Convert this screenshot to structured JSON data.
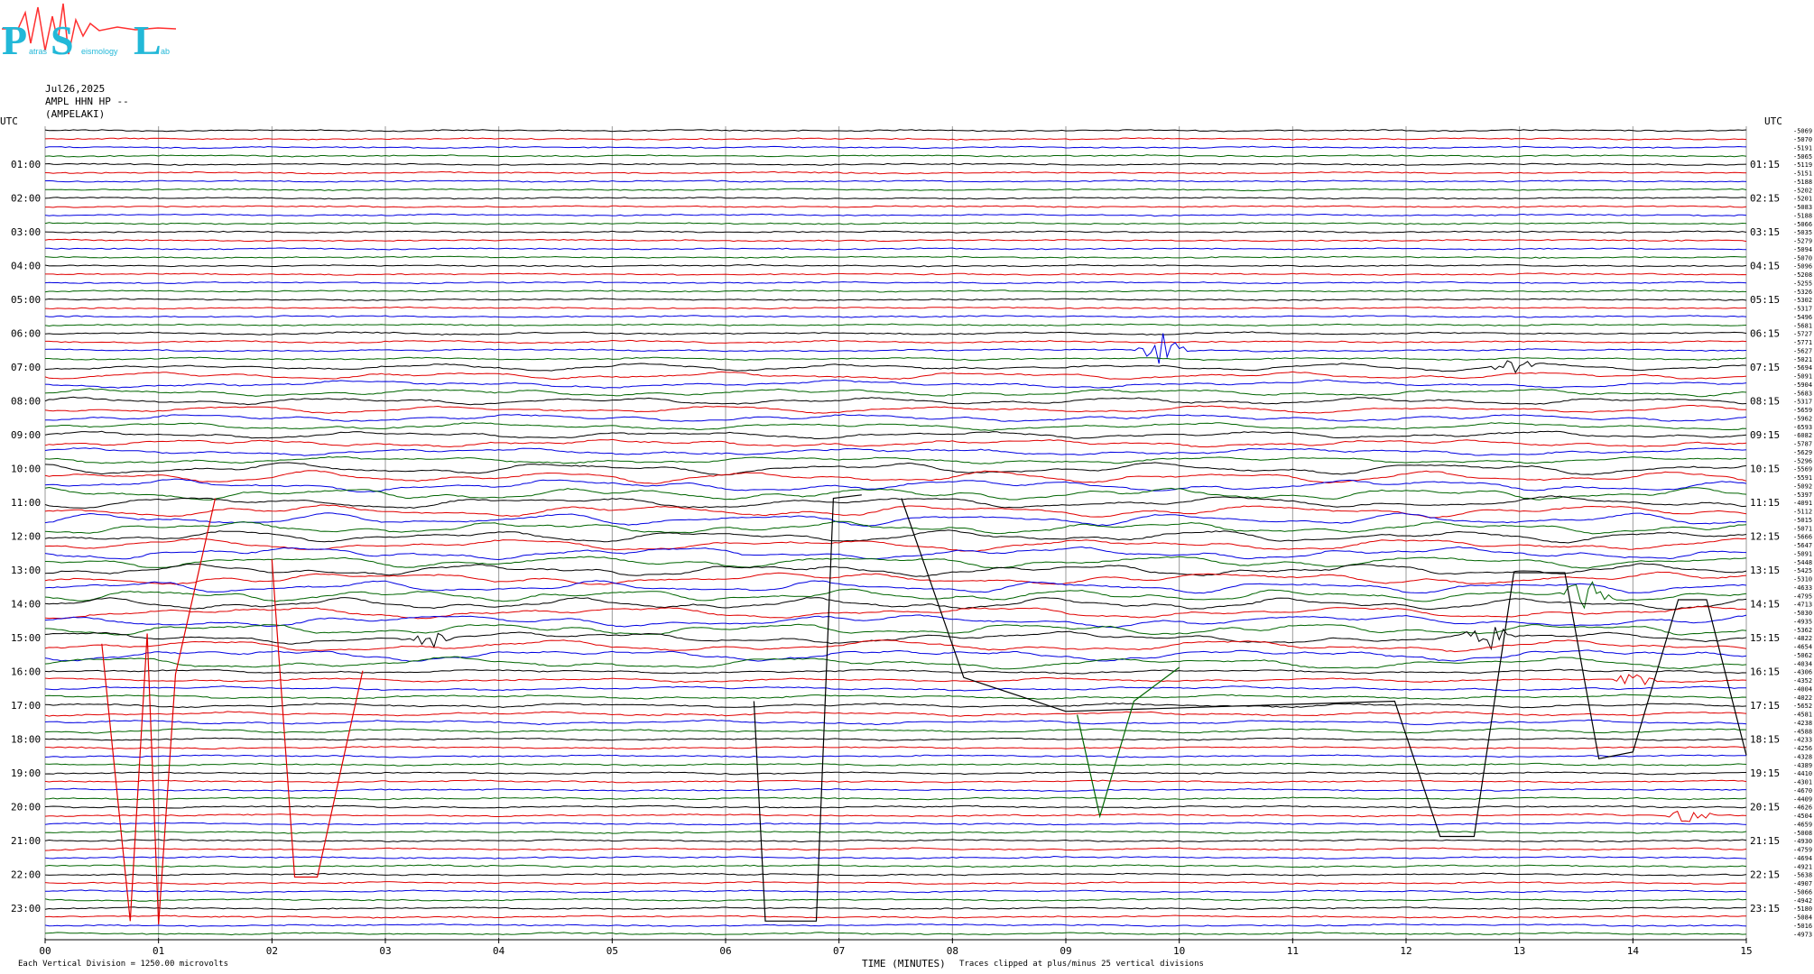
{
  "header": {
    "date": "Jul26,2025",
    "station": "AMPL HHN HP --",
    "location": "(AMPELAKI)"
  },
  "logo": {
    "big_letters": [
      "P",
      "S",
      "L"
    ],
    "small_words": [
      "atras",
      "eismology",
      "ab"
    ],
    "colors": {
      "letters": "#22b8d8",
      "trace": "#ff3030"
    }
  },
  "footer": {
    "scale_note": "Each Vertical Division = 1250.00 microvolts",
    "xlabel": "TIME (MINUTES)",
    "clip_note": "Traces clipped at plus/minus 25 vertical divisions"
  },
  "chart_data": {
    "type": "line",
    "subtype": "helicorder",
    "xlabel": "TIME (MINUTES)",
    "xlim": [
      0,
      15
    ],
    "x_ticks": [
      "00",
      "01",
      "02",
      "03",
      "04",
      "05",
      "06",
      "07",
      "08",
      "09",
      "10",
      "11",
      "12",
      "13",
      "14",
      "15"
    ],
    "left_axis_label": "UTC",
    "right_axis_label": "UTC",
    "left_hour_labels": [
      "01:00",
      "02:00",
      "03:00",
      "04:00",
      "05:00",
      "06:00",
      "07:00",
      "08:00",
      "09:00",
      "10:00",
      "11:00",
      "12:00",
      "13:00",
      "14:00",
      "15:00",
      "16:00",
      "17:00",
      "18:00",
      "19:00",
      "20:00",
      "21:00",
      "22:00",
      "23:00"
    ],
    "right_hour_labels": [
      "01:15",
      "02:15",
      "03:15",
      "04:15",
      "05:15",
      "06:15",
      "07:15",
      "08:15",
      "09:15",
      "10:15",
      "11:15",
      "12:15",
      "13:15",
      "14:15",
      "15:15",
      "16:15",
      "17:15",
      "18:15",
      "19:15",
      "20:15",
      "21:15",
      "22:15",
      "23:15"
    ],
    "rows_per_hour": 4,
    "row_count": 96,
    "line_colors": [
      "#000000",
      "#e00000",
      "#0000e0",
      "#006400"
    ],
    "grid": true,
    "row_mean_counts": [
      "-5069",
      "-5070",
      "-5191",
      "-5065",
      "-5119",
      "-5151",
      "-5188",
      "-5202",
      "-5201",
      "-5083",
      "-5188",
      "-5066",
      "-5035",
      "-5279",
      "-5094",
      "-5070",
      "-5096",
      "-5208",
      "-5255",
      "-5326",
      "-5302",
      "-5317",
      "-5496",
      "-5681",
      "-5727",
      "-5771",
      "-5627",
      "-5021",
      "-5694",
      "-5091",
      "-5904",
      "-5683",
      "-5317",
      "-5659",
      "-5962",
      "-6593",
      "-6082",
      "-5787",
      "-5629",
      "-5296",
      "-5569",
      "-5591",
      "-5092",
      "-5397",
      "-4091",
      "-5112",
      "-5015",
      "-5071",
      "-5666",
      "-5647",
      "-5091",
      "-5448",
      "-5425",
      "-5310",
      "-4633",
      "-4795",
      "-4713",
      "-5030",
      "-4935",
      "-5362",
      "-4822",
      "-4654",
      "-5062",
      "-4034",
      "-4306",
      "-4352",
      "-4004",
      "-4022",
      "-5652",
      "-4581",
      "-4238",
      "-4588",
      "-4233",
      "-4256",
      "-4328",
      "-4389",
      "-4410",
      "-4301",
      "-4670",
      "-4409",
      "-4626",
      "-4504",
      "-4659",
      "-5008",
      "-4930",
      "-4759",
      "-4694",
      "-4921",
      "-5638",
      "-4907",
      "-5066",
      "-4942",
      "-5180",
      "-5084",
      "-5016",
      "-4973"
    ],
    "events": [
      {
        "row": 26,
        "minute": 9.85,
        "amplitude_div": 2.2
      },
      {
        "row": 28,
        "minute": 12.95,
        "amplitude_div": 1.0
      },
      {
        "row": 55,
        "minute": 13.6,
        "amplitude_div": 2.0
      },
      {
        "row": 60,
        "minute": 12.75,
        "amplitude_div": 1.8
      },
      {
        "row": 60,
        "minute": 3.4,
        "amplitude_div": 1.6
      },
      {
        "row": 65,
        "minute": 14.0,
        "amplitude_div": 1.2
      },
      {
        "row": 81,
        "minute": 14.5,
        "amplitude_div": 1.0
      }
    ],
    "clipped_traces": [
      {
        "row": 59,
        "color": "#e00000",
        "points": [
          [
            0.5,
            15.3
          ],
          [
            0.75,
            23.5
          ],
          [
            0.9,
            15.0
          ],
          [
            1.0,
            23.6
          ],
          [
            1.15,
            16.2
          ],
          [
            1.5,
            11.0
          ]
        ]
      },
      {
        "row": 62,
        "color": "#e00000",
        "points": [
          [
            2.0,
            12.8
          ],
          [
            2.2,
            22.2
          ],
          [
            2.4,
            22.2
          ],
          [
            2.8,
            16.1
          ]
        ]
      },
      {
        "row": 70,
        "color": "#000000",
        "points": [
          [
            6.25,
            17.0
          ],
          [
            6.35,
            23.5
          ],
          [
            6.8,
            23.5
          ],
          [
            6.95,
            11.0
          ],
          [
            7.2,
            10.9
          ]
        ]
      },
      {
        "row": 72,
        "color": "#000000",
        "points": [
          [
            7.55,
            11.0
          ],
          [
            8.1,
            16.3
          ],
          [
            9.0,
            17.3
          ],
          [
            11.9,
            17.0
          ],
          [
            12.3,
            21.0
          ],
          [
            12.6,
            21.0
          ],
          [
            12.95,
            13.2
          ],
          [
            13.4,
            13.2
          ],
          [
            13.7,
            18.7
          ],
          [
            14.0,
            18.5
          ],
          [
            14.4,
            14.0
          ],
          [
            14.65,
            14.0
          ],
          [
            15.0,
            18.6
          ]
        ]
      },
      {
        "row": 74,
        "color": "#006400",
        "points": [
          [
            9.1,
            17.4
          ],
          [
            9.3,
            20.4
          ],
          [
            9.6,
            17.0
          ],
          [
            10.0,
            16.0
          ]
        ]
      }
    ]
  }
}
